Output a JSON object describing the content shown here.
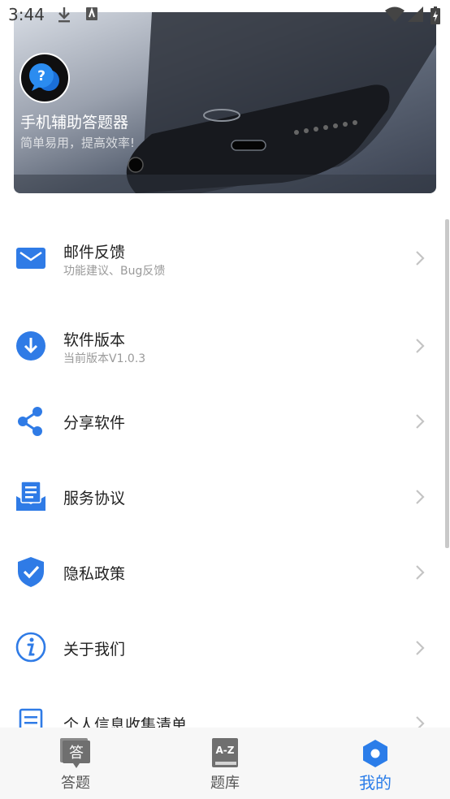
{
  "status_bar": {
    "time": "3:44",
    "icons": [
      "download-icon",
      "notification-icon",
      "wifi-icon",
      "signal-icon",
      "battery-icon"
    ]
  },
  "hero": {
    "app_name": "手机辅助答题器",
    "slogan": "简单易用，提高效率!",
    "logo_icon": "question-chat-bubble-icon"
  },
  "menu": {
    "items": [
      {
        "title": "邮件反馈",
        "subtitle": "功能建议、Bug反馈",
        "icon": "mail-icon"
      },
      {
        "title": "软件版本",
        "subtitle": "当前版本V1.0.3",
        "icon": "download-circle-icon"
      },
      {
        "title": "分享软件",
        "icon": "share-icon"
      },
      {
        "title": "服务协议",
        "icon": "agreement-icon"
      },
      {
        "title": "隐私政策",
        "icon": "shield-check-icon"
      },
      {
        "title": "关于我们",
        "icon": "info-icon"
      },
      {
        "title": "个人信息收集清单",
        "icon": "list-icon"
      }
    ]
  },
  "bottom_nav": {
    "tabs": [
      {
        "label": "答题",
        "icon_text": "答",
        "icon": "answer-icon"
      },
      {
        "label": "题库",
        "icon_text": "A-Z",
        "icon": "question-bank-icon"
      },
      {
        "label": "我的",
        "icon": "hexagon-profile-icon",
        "active": true
      }
    ]
  },
  "colors": {
    "accent": "#2b7de9",
    "icon_blue": "#2f7be6",
    "chevron": "#c4c4c4"
  }
}
